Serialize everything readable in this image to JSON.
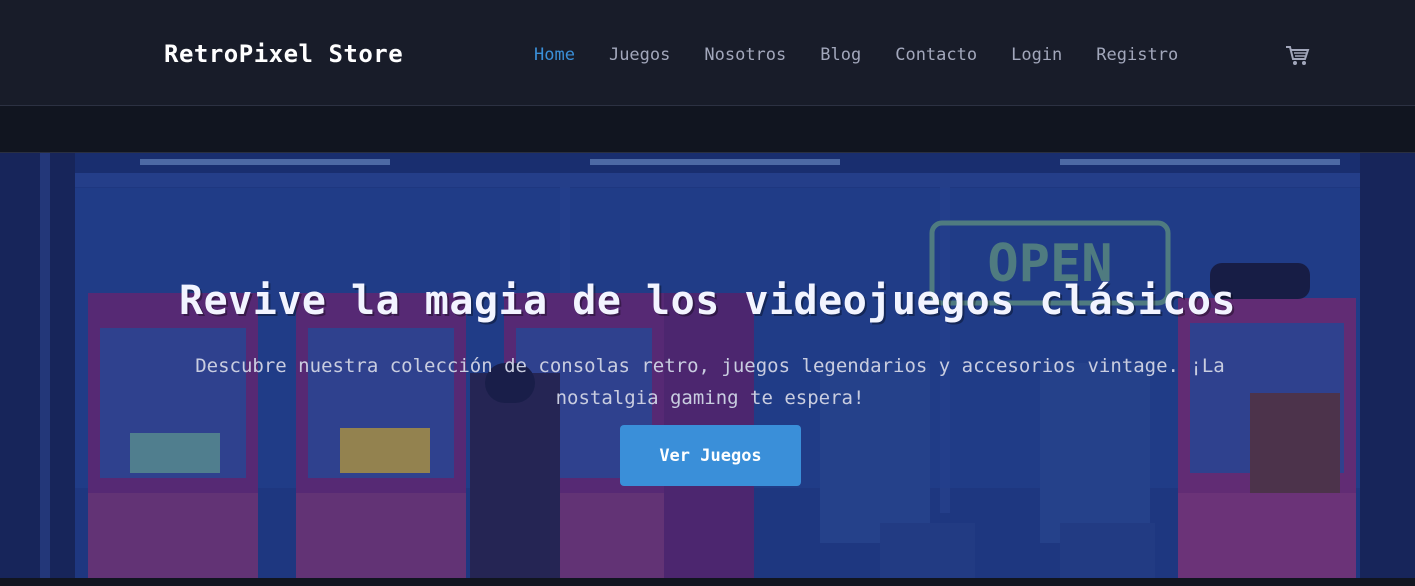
{
  "brand": {
    "name": "RetroPixel Store"
  },
  "nav": {
    "items": [
      {
        "label": "Home",
        "active": true
      },
      {
        "label": "Juegos",
        "active": false
      },
      {
        "label": "Nosotros",
        "active": false
      },
      {
        "label": "Blog",
        "active": false
      },
      {
        "label": "Contacto",
        "active": false
      },
      {
        "label": "Login",
        "active": false
      },
      {
        "label": "Registro",
        "active": false
      }
    ],
    "cart_icon": "shopping-cart-icon"
  },
  "hero": {
    "title": "Revive la magia de los videojuegos clásicos",
    "subtitle": "Descubre nuestra colección de consolas retro, juegos legendarios y accesorios vintage. ¡La nostalgia gaming te espera!",
    "cta_label": "Ver Juegos",
    "background": "pixel-art-arcade-scene",
    "sign_text": "OPEN"
  },
  "colors": {
    "accent": "#3a8fd9",
    "nav_bg": "#181c29",
    "page_bg": "#111520",
    "text_muted": "#a2a7bb"
  }
}
